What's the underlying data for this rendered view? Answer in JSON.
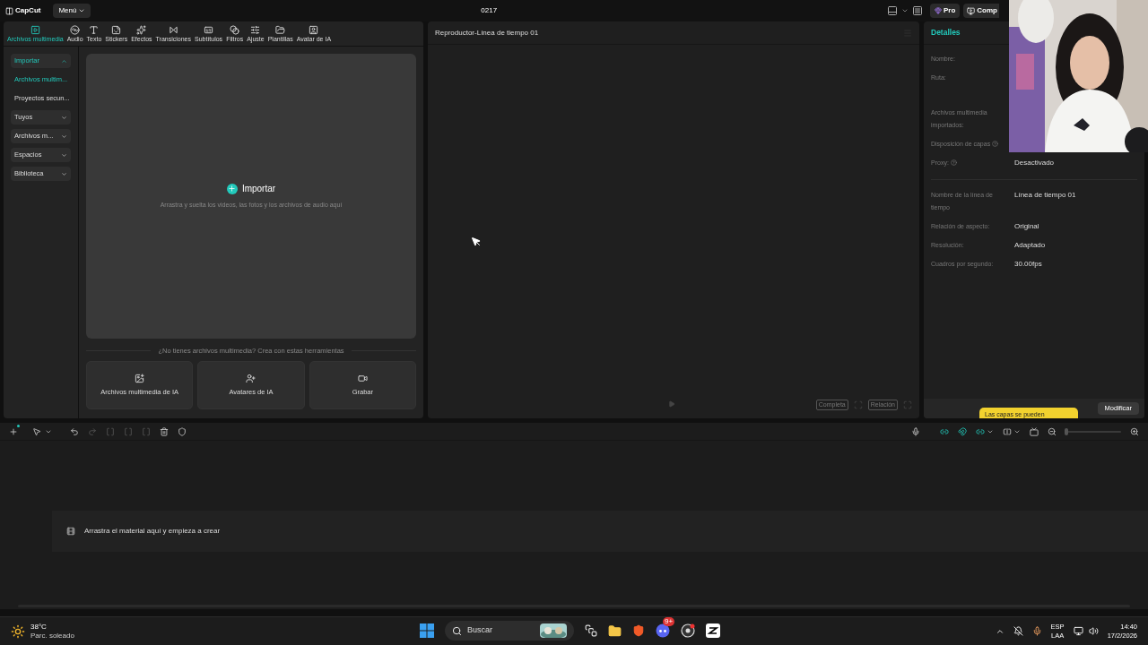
{
  "app": {
    "logo": "CapCut",
    "menu": "Menú",
    "title": "0217",
    "pro": "Pro",
    "share": "Comp"
  },
  "toolbar_tabs": [
    {
      "label": "Archivos multimedia",
      "selected": true
    },
    {
      "label": "Audio",
      "selected": false
    },
    {
      "label": "Texto",
      "selected": false
    },
    {
      "label": "Stickers",
      "selected": false
    },
    {
      "label": "Efectos",
      "selected": false
    },
    {
      "label": "Transiciones",
      "selected": false
    },
    {
      "label": "Subtítulos",
      "selected": false
    },
    {
      "label": "Filtros",
      "selected": false
    },
    {
      "label": "Ajuste",
      "selected": false
    },
    {
      "label": "Plantillas",
      "selected": false
    },
    {
      "label": "Avatar de IA",
      "selected": false
    }
  ],
  "media_sidebar": [
    {
      "label": "Importar",
      "kind": "group",
      "expanded": true,
      "selected": true
    },
    {
      "label": "Archivos multim...",
      "kind": "sub",
      "selected": true
    },
    {
      "label": "Proyectos secun...",
      "kind": "sub",
      "selected": false
    },
    {
      "label": "Tuyos",
      "kind": "group",
      "expanded": false,
      "selected": false
    },
    {
      "label": "Archivos m...",
      "kind": "group",
      "expanded": false,
      "selected": false
    },
    {
      "label": "Espacios",
      "kind": "group",
      "expanded": false,
      "selected": false
    },
    {
      "label": "Biblioteca",
      "kind": "group",
      "expanded": false,
      "selected": false
    }
  ],
  "import_area": {
    "button": "Importar",
    "hint": "Arrastra y suelta los videos, las fotos y los archivos de audio aquí"
  },
  "tools": {
    "heading": "¿No tienes archivos multimedia? Crea con estas herramientas",
    "buttons": [
      "Archivos multimedia de IA",
      "Avatares de IA",
      "Grabar"
    ]
  },
  "player": {
    "title": "Reproductor-Línea de tiempo 01",
    "controls": [
      "Completa",
      "Relación"
    ]
  },
  "details": {
    "title": "Detalles",
    "fields": [
      {
        "label": "Nombre:",
        "help": false,
        "divider": false
      },
      {
        "label": "Ruta:",
        "help": false,
        "divider": false
      },
      {
        "label": "Archivos multimedia importados:",
        "help": false,
        "divider": false
      },
      {
        "label": "Disposición de capas",
        "help": true,
        "divider": false
      },
      {
        "label": "Proxy:",
        "help": true,
        "value": "Desactivado",
        "divider": false
      },
      {
        "label": "Nombre de la línea de tiempo",
        "help": false,
        "value": "Línea de tiempo 01",
        "divider": true
      },
      {
        "label": "Relación de aspecto:",
        "help": false,
        "value": "Original",
        "divider": false
      },
      {
        "label": "Resolución:",
        "help": false,
        "value": "Adaptado",
        "divider": false
      },
      {
        "label": "Cuadros por segundo:",
        "help": false,
        "value": "30.00fps",
        "divider": false
      }
    ],
    "button": "Modificar",
    "tooltip": "Las capas se pueden"
  },
  "timeline": {
    "hint": "Arrastra el material aquí y empieza a crear",
    "zoom": {
      "level": 0.02
    }
  },
  "taskbar": {
    "temperature": "38°C",
    "weather": "Parc. soleado",
    "search": "Buscar",
    "badge": "9+",
    "language": "ESP",
    "layout": "LAA",
    "time": "14:40",
    "date": "17/2/2026"
  }
}
